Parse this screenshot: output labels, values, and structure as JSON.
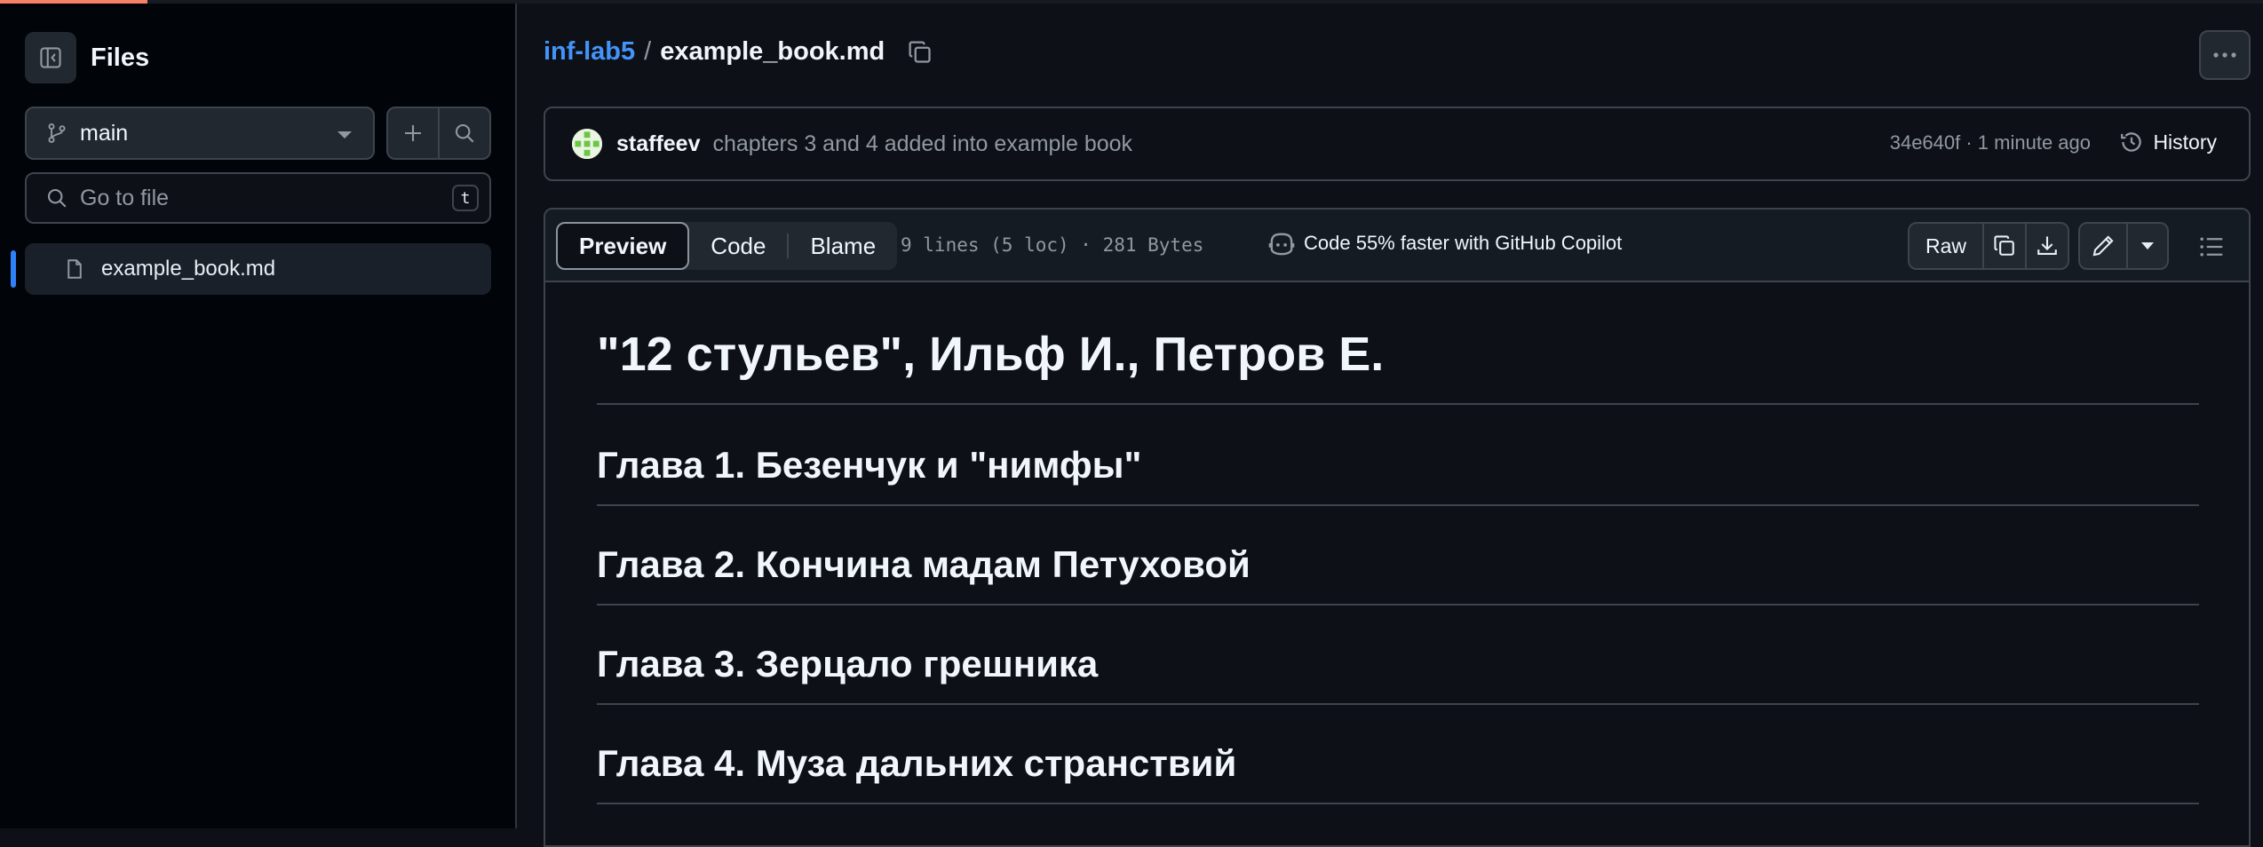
{
  "sidebar": {
    "title": "Files",
    "branch": "main",
    "search_placeholder": "Go to file",
    "search_shortcut": "t",
    "files": [
      {
        "name": "example_book.md",
        "active": true
      }
    ]
  },
  "breadcrumb": {
    "repo": "inf-lab5",
    "separator": "/",
    "file": "example_book.md"
  },
  "commit": {
    "author": "staffeev",
    "message": "chapters 3 and 4 added into example book",
    "meta": "34e640f · 1 minute ago",
    "history_label": "History"
  },
  "file_header": {
    "tabs": [
      "Preview",
      "Code",
      "Blame"
    ],
    "selected_tab": "Preview",
    "lines_info": "9 lines (5 loc) · 281 Bytes",
    "copilot_text": "Code 55% faster with GitHub Copilot",
    "raw_label": "Raw"
  },
  "content": {
    "h1": "\"12 стульев\", Ильф И., Петров Е.",
    "chapters": [
      "Глава 1. Безенчук и \"нимфы\"",
      "Глава 2. Кончина мадам Петуховой",
      "Глава 3. Зерцало грешника",
      "Глава 4. Муза дальних странствий"
    ]
  },
  "colors": {
    "background": "#0d1117",
    "accent": "#4493f8",
    "progress": "#f78166",
    "border": "#3d444d"
  }
}
